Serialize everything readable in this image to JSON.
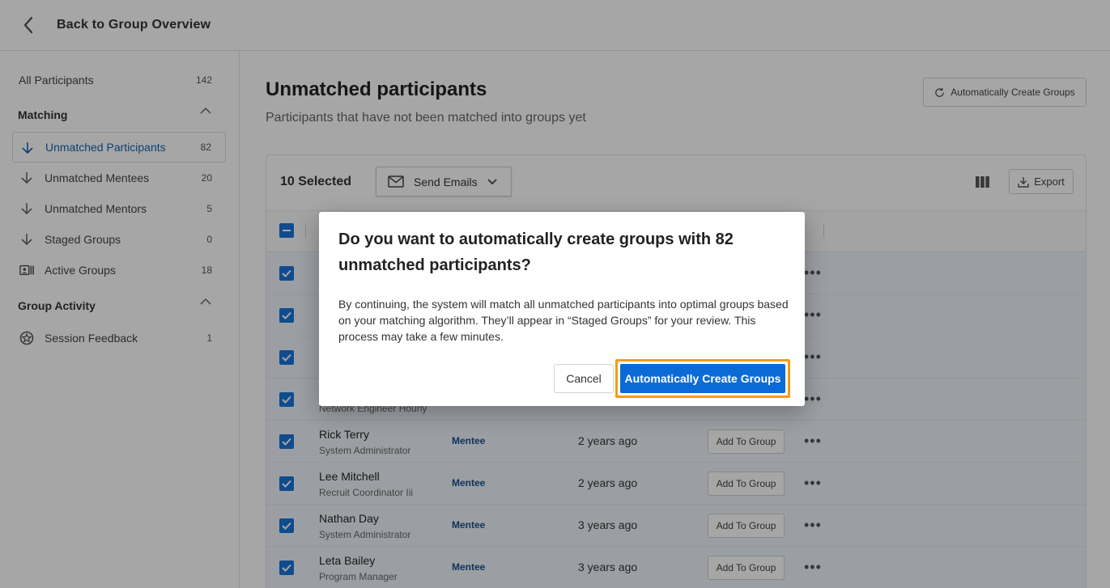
{
  "header": {
    "back_label": "Back to Group Overview"
  },
  "sidebar": {
    "all": {
      "label": "All Participants",
      "count": "142"
    },
    "sections": [
      {
        "title": "Matching",
        "items": [
          {
            "label": "Unmatched Participants",
            "count": "82",
            "icon": "arrow-down-icon"
          },
          {
            "label": "Unmatched Mentees",
            "count": "20",
            "icon": "arrow-down-icon"
          },
          {
            "label": "Unmatched Mentors",
            "count": "5",
            "icon": "arrow-down-icon"
          },
          {
            "label": "Staged Groups",
            "count": "0",
            "icon": "arrow-down-icon"
          },
          {
            "label": "Active Groups",
            "count": "18",
            "icon": "id-card-icon"
          }
        ]
      },
      {
        "title": "Group Activity",
        "items": [
          {
            "label": "Session Feedback",
            "count": "1",
            "icon": "feedback-badge-icon"
          }
        ]
      }
    ]
  },
  "main": {
    "title": "Unmatched participants",
    "subtitle": "Participants that have not been matched into groups yet",
    "auto_create_label": "Automatically Create Groups",
    "selected_count": "10 Selected",
    "send_emails_label": "Send Emails",
    "export_label": "Export",
    "rows": [
      {
        "name": "",
        "role": "",
        "type": "",
        "when": "",
        "action": ""
      },
      {
        "name": "",
        "role": "",
        "type": "",
        "when": "",
        "action": ""
      },
      {
        "name": "",
        "role": "",
        "type": "",
        "when": "",
        "action": ""
      },
      {
        "name": "",
        "role": "Network Engineer Hourly",
        "type": "",
        "when": "",
        "action": ""
      },
      {
        "name": "Rick Terry",
        "role": "System Administrator",
        "type": "Mentee",
        "when": "2 years ago",
        "action": "Add To Group"
      },
      {
        "name": "Lee Mitchell",
        "role": "Recruit Coordinator Iii",
        "type": "Mentee",
        "when": "2 years ago",
        "action": "Add To Group"
      },
      {
        "name": "Nathan Day",
        "role": "System Administrator",
        "type": "Mentee",
        "when": "3 years ago",
        "action": "Add To Group"
      },
      {
        "name": "Leta Bailey",
        "role": "Program Manager",
        "type": "Mentee",
        "when": "3 years ago",
        "action": "Add To Group"
      }
    ]
  },
  "modal": {
    "title": "Do you want to automatically create groups with 82 unmatched participants?",
    "body": "By continuing, the system will match all unmatched participants into optimal groups based on your matching algorithm. They’ll appear in “Staged Groups” for your review. This process may take a few minutes.",
    "cancel_label": "Cancel",
    "confirm_label": "Automatically Create Groups"
  },
  "colors": {
    "accent": "#0a6bd6",
    "highlight": "#f39c12",
    "active_nav": "#1463b3",
    "type_text": "#1a4f8a"
  }
}
